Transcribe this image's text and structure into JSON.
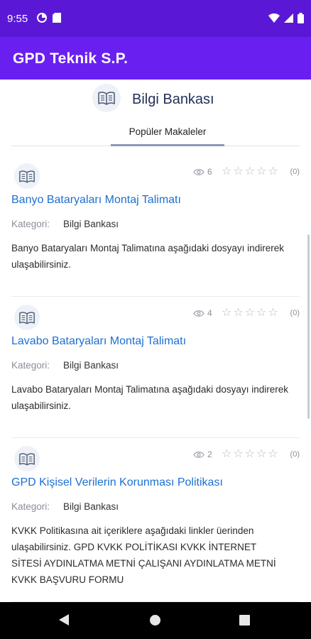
{
  "status_bar": {
    "time": "9:55",
    "left_icons": [
      "data-saver-icon",
      "sd-card-icon"
    ],
    "right_icons": [
      "wifi-icon",
      "signal-icon",
      "battery-icon"
    ]
  },
  "app_bar": {
    "title": "GPD Teknik S.P.",
    "color": "#6a1ff1"
  },
  "knowledge_base": {
    "title": "Bilgi Bankası",
    "icon": "book-icon"
  },
  "tabs": [
    {
      "label": "Popüler Makaleler",
      "active": true
    }
  ],
  "articles": [
    {
      "title": "Banyo Bataryaları Montaj Talimatı",
      "views": "6",
      "rating_count": "(0)",
      "stars": 0,
      "category_label": "Kategori:",
      "category": "Bilgi Bankası",
      "description": "Banyo Bataryaları Montaj Talimatına aşağıdaki dosyayı indirerek ulaşabilirsiniz."
    },
    {
      "title": "Lavabo Bataryaları Montaj Talimatı",
      "views": "4",
      "rating_count": "(0)",
      "stars": 0,
      "category_label": "Kategori:",
      "category": "Bilgi Bankası",
      "description": "Lavabo Bataryaları Montaj Talimatına aşağıdaki dosyayı indirerek ulaşabilirsiniz."
    },
    {
      "title": "GPD Kişisel Verilerin Korunması Politikası",
      "views": "2",
      "rating_count": "(0)",
      "stars": 0,
      "category_label": "Kategori:",
      "category": "Bilgi Bankası",
      "description": "KVKK Politikasına ait içeriklere aşağıdaki linkler üerinden ulaşabilirsiniz.   GPD KVKK POLİTİKASI KVKK İNTERNET SİTESİ AYDINLATMA METNİ ÇALIŞANI AYDINLATMA METNİ KVKK BAŞVURU FORMU"
    }
  ],
  "colors": {
    "status_bar": "#5a18d6",
    "link": "#1d6fd1",
    "title": "#22305a"
  }
}
